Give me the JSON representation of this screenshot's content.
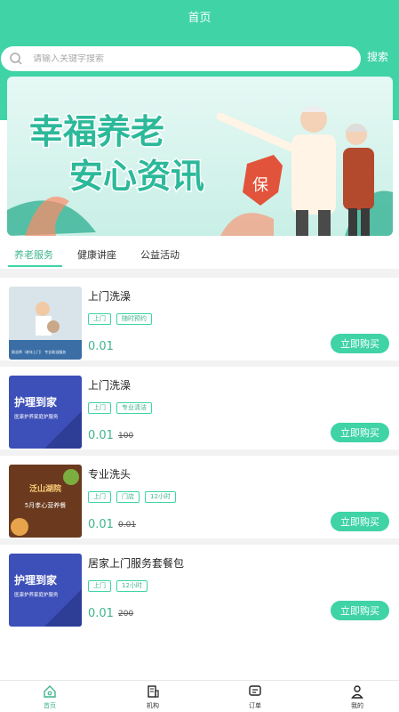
{
  "header": {
    "title": "首页"
  },
  "search": {
    "placeholder": "请输入关键字搜索",
    "button_label": "搜索"
  },
  "banner": {
    "line1": "幸福养老",
    "line2": "安心资讯",
    "badge": "保"
  },
  "tabs": [
    {
      "label": "养老服务",
      "active": true
    },
    {
      "label": "健康讲座",
      "active": false
    },
    {
      "label": "公益活动",
      "active": false
    }
  ],
  "services": [
    {
      "name": "上门洗澡",
      "tags": [
        "上门",
        "随时预约"
      ],
      "price": "0.01",
      "original_price": "",
      "buy_label": "立即购买",
      "thumb_caption": "助浴师（老年上门）   专业助浴服务"
    },
    {
      "name": "上门洗澡",
      "tags": [
        "上门",
        "专业清洁"
      ],
      "price": "0.01",
      "original_price": "100",
      "buy_label": "立即购买",
      "thumb_title": "护理到家",
      "thumb_sub": "医康护养家庭护服务"
    },
    {
      "name": "专业洗头",
      "tags": [
        "上门",
        "门店",
        "12小时"
      ],
      "price": "0.01",
      "original_price": "0.01",
      "buy_label": "立即购买",
      "thumb_title": "5月孝心营养餐",
      "thumb_sub": "泛山湖院"
    },
    {
      "name": "居家上门服务套餐包",
      "tags": [
        "上门",
        "12小时"
      ],
      "price": "0.01",
      "original_price": "200",
      "buy_label": "立即购买",
      "thumb_title": "护理到家",
      "thumb_sub": "医康护养家庭护服务"
    }
  ],
  "tabbar": [
    {
      "label": "首页",
      "icon": "home-icon",
      "active": true
    },
    {
      "label": "机构",
      "icon": "building-icon",
      "active": false
    },
    {
      "label": "订单",
      "icon": "order-icon",
      "active": false
    },
    {
      "label": "我的",
      "icon": "user-icon",
      "active": false
    }
  ],
  "colors": {
    "accent": "#3fd3a6",
    "accent_text": "#3fb58c"
  }
}
